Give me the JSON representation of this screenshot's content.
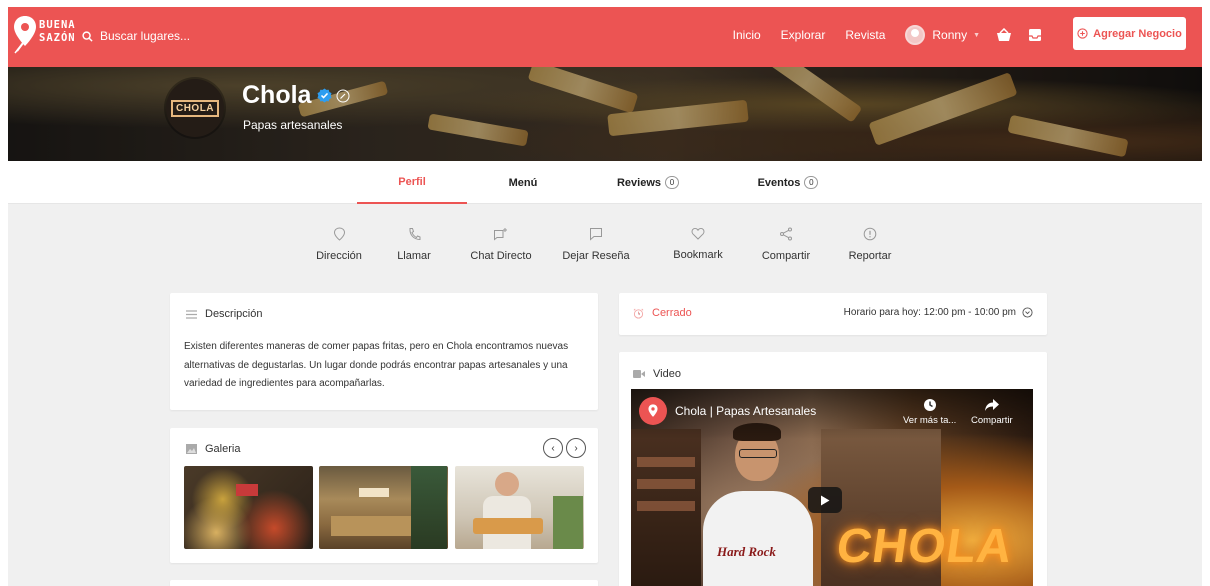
{
  "brand": {
    "name_line1": "BUENA",
    "name_line2": "SAZÓN",
    "accent": "#ec5453"
  },
  "search": {
    "placeholder": "Buscar lugares..."
  },
  "nav": {
    "items": [
      "Inicio",
      "Explorar",
      "Revista"
    ],
    "user": "Ronny",
    "cta": "Agregar Negocio"
  },
  "business": {
    "logo_text": "CHOLA",
    "name": "Chola",
    "subtitle": "Papas artesanales",
    "verified": true
  },
  "tabs": [
    {
      "label": "Perfil",
      "active": true
    },
    {
      "label": "Menú"
    },
    {
      "label": "Reviews",
      "count": "0"
    },
    {
      "label": "Eventos",
      "count": "0"
    }
  ],
  "actions": [
    {
      "label": "Dirección",
      "icon": "map-pin-icon"
    },
    {
      "label": "Llamar",
      "icon": "phone-icon"
    },
    {
      "label": "Chat Directo",
      "icon": "chat-icon"
    },
    {
      "label": "Dejar Reseña",
      "icon": "review-icon"
    },
    {
      "label": "Bookmark",
      "icon": "heart-icon"
    },
    {
      "label": "Compartir",
      "icon": "share-icon"
    },
    {
      "label": "Reportar",
      "icon": "report-icon"
    }
  ],
  "description": {
    "title": "Descripción",
    "text": "Existen diferentes maneras de comer papas fritas, pero en Chola encontramos nuevas alternativas de degustarlas. Un lugar donde podrás encontrar papas artesanales y una variedad de ingredientes para acompañarlas."
  },
  "gallery": {
    "title": "Galeria"
  },
  "hours": {
    "status": "Cerrado",
    "status_color": "#ec5453",
    "today": "Horario para hoy: 12:00 pm - 10:00 pm"
  },
  "video": {
    "title": "Video",
    "player_title": "Chola | Papas Artesanales",
    "watch_later": "Ver más ta...",
    "share": "Compartir",
    "neon_text": "CHOLA",
    "shirt_text": "Hard Rock"
  }
}
